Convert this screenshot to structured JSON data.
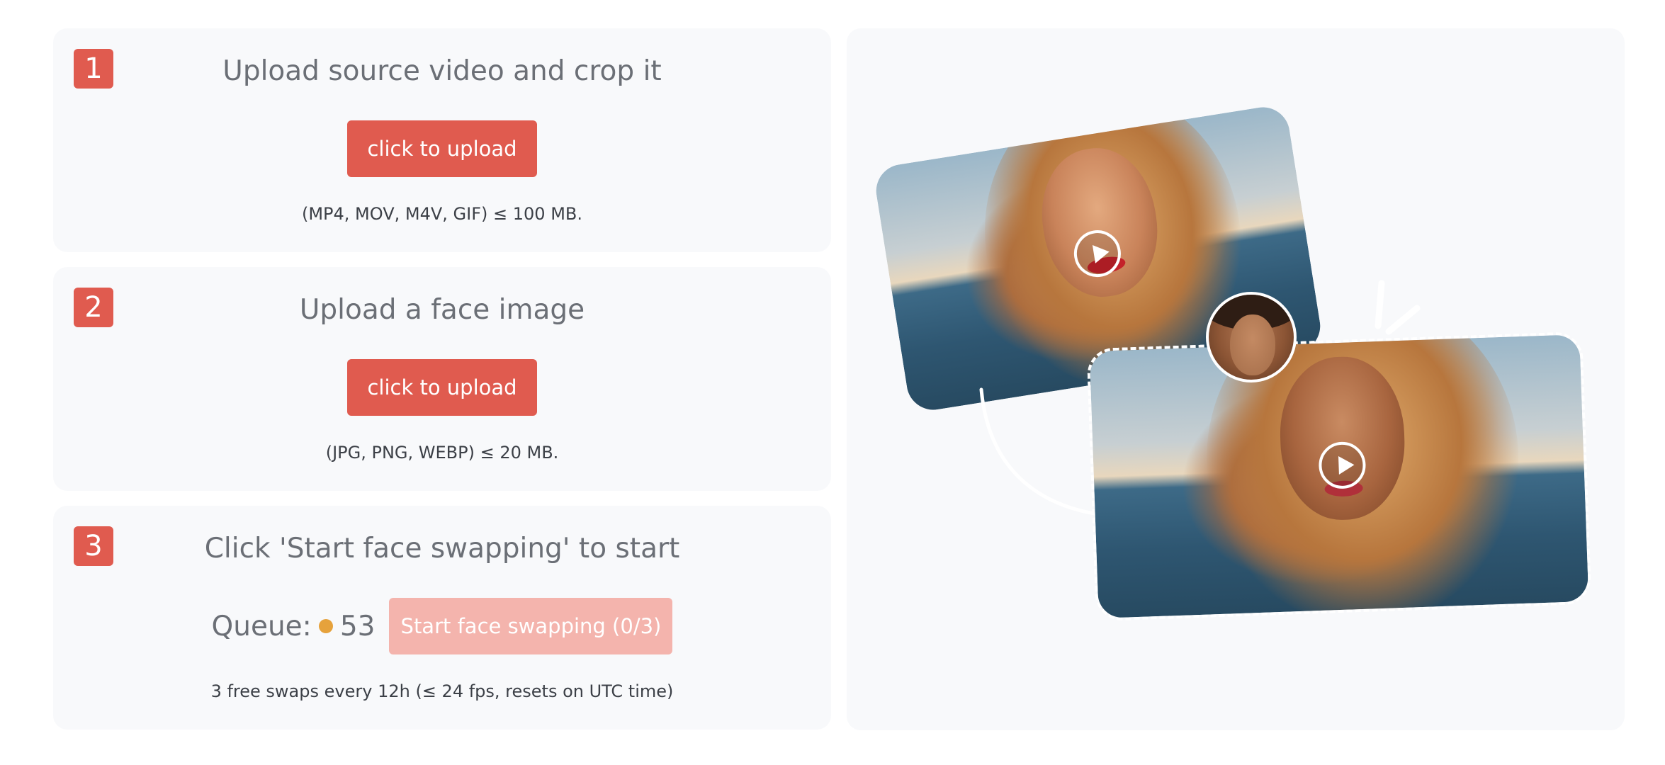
{
  "steps": [
    {
      "number": "1",
      "title": "Upload source video and crop it",
      "button_label": "click to upload",
      "hint": "(MP4, MOV, M4V, GIF) ≤ 100 MB."
    },
    {
      "number": "2",
      "title": "Upload a face image",
      "button_label": "click to upload",
      "hint": "(JPG, PNG, WEBP) ≤ 20 MB."
    },
    {
      "number": "3",
      "title": "Click 'Start face swapping' to start",
      "queue_label": "Queue:",
      "queue_count": "53",
      "queue_dot_color": "#e6a23c",
      "start_button_label": "Start face swapping (0/3)",
      "hint": "3 free swaps every 12h (≤ 24 fps, resets on UTC time)"
    }
  ],
  "colors": {
    "accent": "#e05b4f",
    "accent_disabled": "#f4b4ad",
    "card_bg": "#f8f9fb",
    "title_text": "#6b6f76"
  },
  "preview": {
    "icons": [
      "play-icon",
      "play-icon",
      "arrow-icon",
      "sparkle-icon"
    ]
  }
}
